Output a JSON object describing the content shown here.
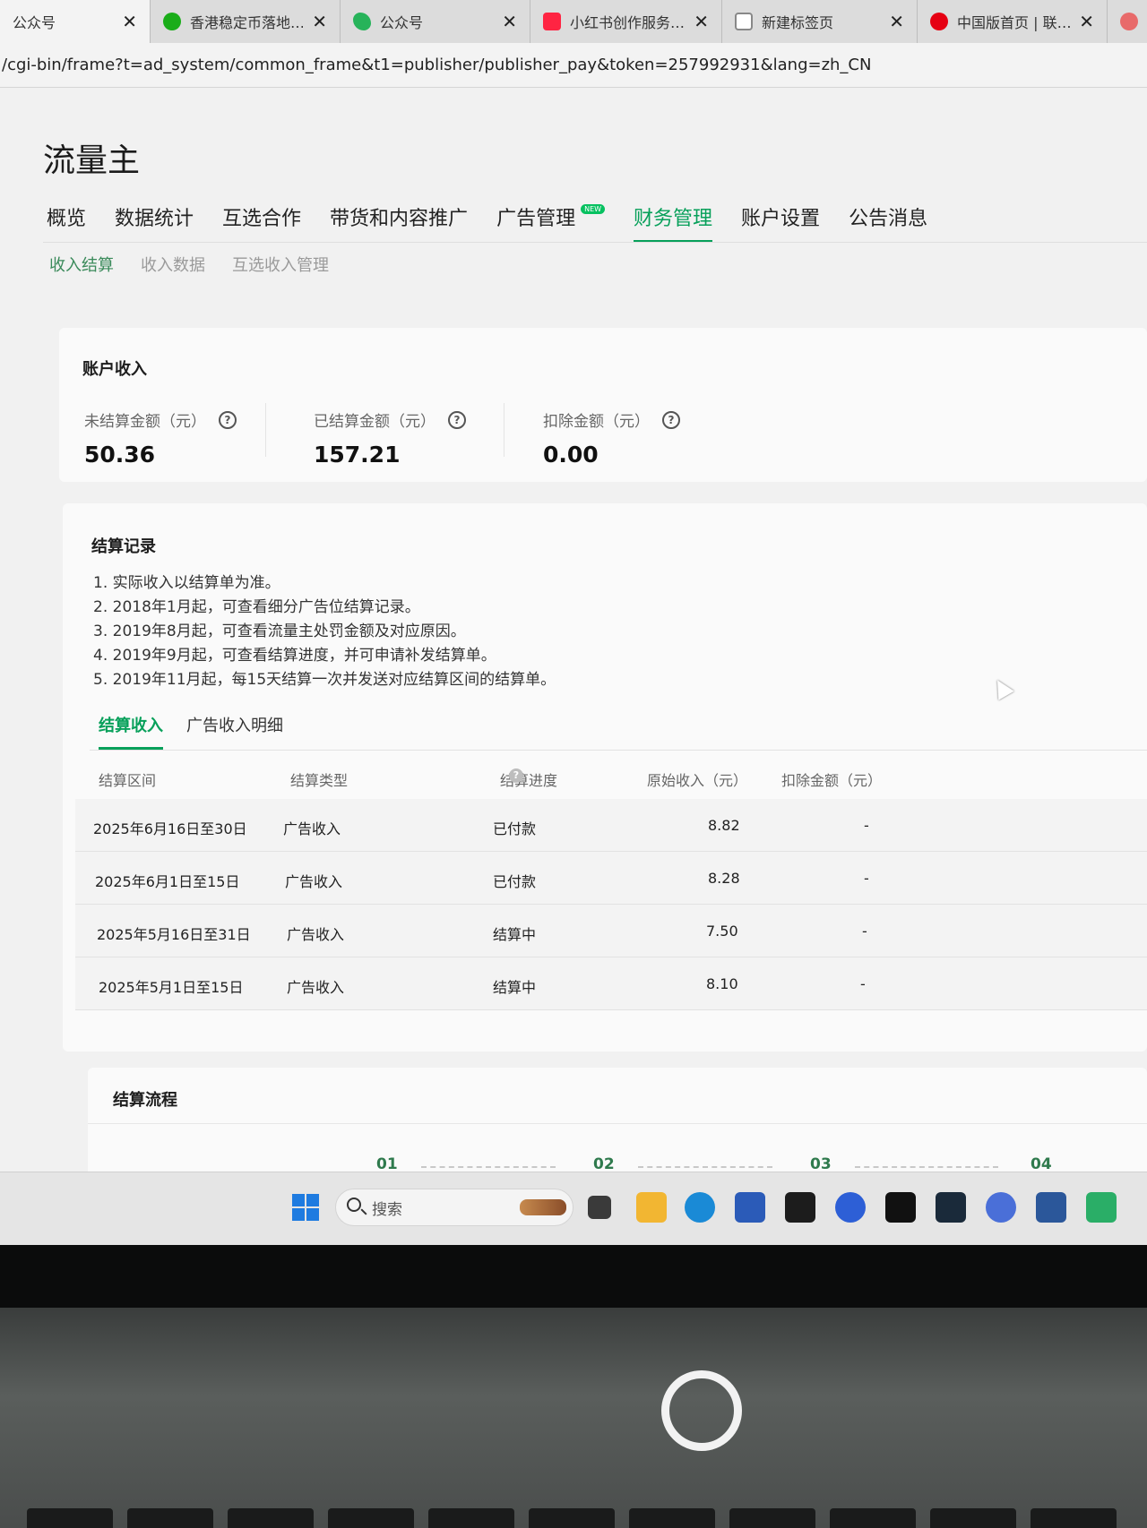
{
  "browser": {
    "tabs": [
      {
        "title": "公众号",
        "icon": "wechat-official-icon",
        "color": "#dcdcdc",
        "active": true
      },
      {
        "title": "香港稳定币落地…",
        "icon": "green-circle-icon",
        "color": "#1aad19"
      },
      {
        "title": "公众号",
        "icon": "wechat-official-icon",
        "color": "#27b35a"
      },
      {
        "title": "小红书创作服务…",
        "icon": "xiaohongshu-icon",
        "color": "#ff2442"
      },
      {
        "title": "新建标签页",
        "icon": "new-tab-icon",
        "color": "#888888"
      },
      {
        "title": "中国版首页 | 联…",
        "icon": "unicom-icon",
        "color": "#e60012"
      }
    ],
    "tab_close": "✕",
    "url": "/cgi-bin/frame?t=ad_system/common_frame&t1=publisher/publisher_pay&token=257992931&lang=zh_CN"
  },
  "app": {
    "title": "流量主",
    "main_nav": [
      {
        "label": "概览"
      },
      {
        "label": "数据统计"
      },
      {
        "label": "互选合作"
      },
      {
        "label": "带货和内容推广"
      },
      {
        "label": "广告管理",
        "badge": "NEW"
      },
      {
        "label": "财务管理",
        "active": true
      },
      {
        "label": "账户设置"
      },
      {
        "label": "公告消息"
      }
    ],
    "sub_nav": [
      {
        "label": "收入结算",
        "active": true
      },
      {
        "label": "收入数据"
      },
      {
        "label": "互选收入管理"
      }
    ]
  },
  "income": {
    "title": "账户收入",
    "metrics": [
      {
        "label": "未结算金额（元）",
        "value": "50.36"
      },
      {
        "label": "已结算金额（元）",
        "value": "157.21"
      },
      {
        "label": "扣除金额（元）",
        "value": "0.00"
      }
    ],
    "help_glyph": "?"
  },
  "records": {
    "title": "结算记录",
    "notes": [
      "1. 实际收入以结算单为准。",
      "2. 2018年1月起，可查看细分广告位结算记录。",
      "3. 2019年8月起，可查看流量主处罚金额及对应原因。",
      "4. 2019年9月起，可查看结算进度，并可申请补发结算单。",
      "5. 2019年11月起，每15天结算一次并发送对应结算区间的结算单。"
    ],
    "tabs": [
      {
        "label": "结算收入",
        "active": true
      },
      {
        "label": "广告收入明细"
      }
    ],
    "columns": [
      "结算区间",
      "结算类型",
      "结算进度",
      "原始收入（元）",
      "扣除金额（元）"
    ],
    "rows": [
      {
        "period": "2025年6月16日至30日",
        "type": "广告收入",
        "status": "已付款",
        "income": "8.82",
        "deduct": "-"
      },
      {
        "period": "2025年6月1日至15日",
        "type": "广告收入",
        "status": "已付款",
        "income": "8.28",
        "deduct": "-"
      },
      {
        "period": "2025年5月16日至31日",
        "type": "广告收入",
        "status": "结算中",
        "income": "7.50",
        "deduct": "-"
      },
      {
        "period": "2025年5月1日至15日",
        "type": "广告收入",
        "status": "结算中",
        "income": "8.10",
        "deduct": "-"
      }
    ]
  },
  "flow": {
    "title": "结算流程",
    "steps": [
      "01",
      "02",
      "03",
      "04"
    ]
  },
  "taskbar": {
    "search_placeholder": "搜索",
    "apps": [
      "task-view-icon",
      "file-explorer-icon",
      "edge-browser-icon",
      "store-icon",
      "app-icon",
      "zoom-icon",
      "capcut-icon",
      "tool-icon",
      "app-whale-icon",
      "word-icon",
      "wechat-icon"
    ]
  },
  "colors": {
    "accent": "#07a05a",
    "badge": "#07c160"
  }
}
